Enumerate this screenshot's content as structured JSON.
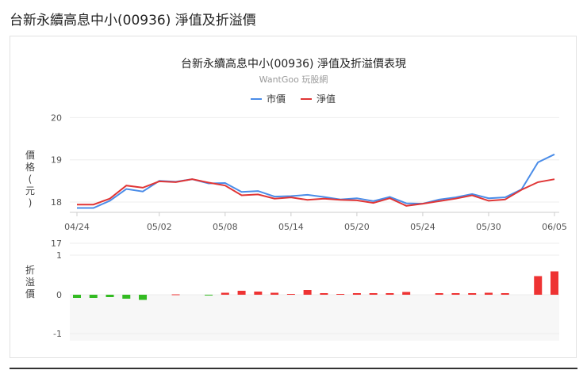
{
  "page_title": "台新永續高息中小(00936) 淨值及折溢價",
  "chart_data": [
    {
      "type": "line",
      "title": "台新永續高息中小(00936) 淨值及折溢價表現",
      "subtitle": "WantGoo 玩股網",
      "ylabel": "價格(元)",
      "xlabel": "",
      "ylim": [
        17.7,
        20
      ],
      "yticks": [
        "20",
        "19",
        "18"
      ],
      "ytick_values": [
        20,
        19,
        18
      ],
      "xtick_labels": [
        "04/24",
        "05/02",
        "05/08",
        "05/14",
        "05/20",
        "05/24",
        "05/30",
        "06/05"
      ],
      "xtick_index": [
        0,
        5,
        9,
        13,
        17,
        21,
        25,
        29
      ],
      "legend_placement": "top-center",
      "series": [
        {
          "name": "市價",
          "color": "#4a8ce8",
          "values": [
            17.86,
            17.86,
            18.03,
            18.31,
            18.25,
            18.5,
            18.48,
            18.54,
            18.44,
            18.45,
            18.24,
            18.26,
            18.13,
            18.14,
            18.17,
            18.12,
            18.06,
            18.09,
            18.02,
            18.12,
            17.97,
            17.96,
            18.06,
            18.11,
            18.19,
            18.09,
            18.11,
            18.3,
            18.94,
            19.13
          ]
        },
        {
          "name": "淨值",
          "color": "#e03535",
          "values": [
            17.94,
            17.94,
            18.08,
            18.39,
            18.34,
            18.49,
            18.47,
            18.54,
            18.46,
            18.39,
            18.16,
            18.18,
            18.08,
            18.11,
            18.05,
            18.08,
            18.05,
            18.04,
            17.98,
            18.09,
            17.91,
            17.96,
            18.02,
            18.08,
            18.16,
            18.03,
            18.06,
            18.29,
            18.47,
            18.54
          ]
        }
      ]
    },
    {
      "type": "bar",
      "ylabel": "折溢價",
      "yticks": [
        "17",
        "1",
        "0",
        "-1"
      ],
      "ylim": [
        -1,
        1
      ],
      "positive_color": "#ee3333",
      "negative_color": "#33bb22",
      "values": [
        -0.08,
        -0.08,
        -0.06,
        -0.1,
        -0.13,
        0,
        0.01,
        0,
        -0.01,
        0.05,
        0.1,
        0.08,
        0.05,
        0.02,
        0.12,
        0.04,
        0.02,
        0.04,
        0.04,
        0.04,
        0.07,
        0,
        0.04,
        0.04,
        0.04,
        0.05,
        0.04,
        0,
        0.47,
        0.59
      ]
    }
  ]
}
